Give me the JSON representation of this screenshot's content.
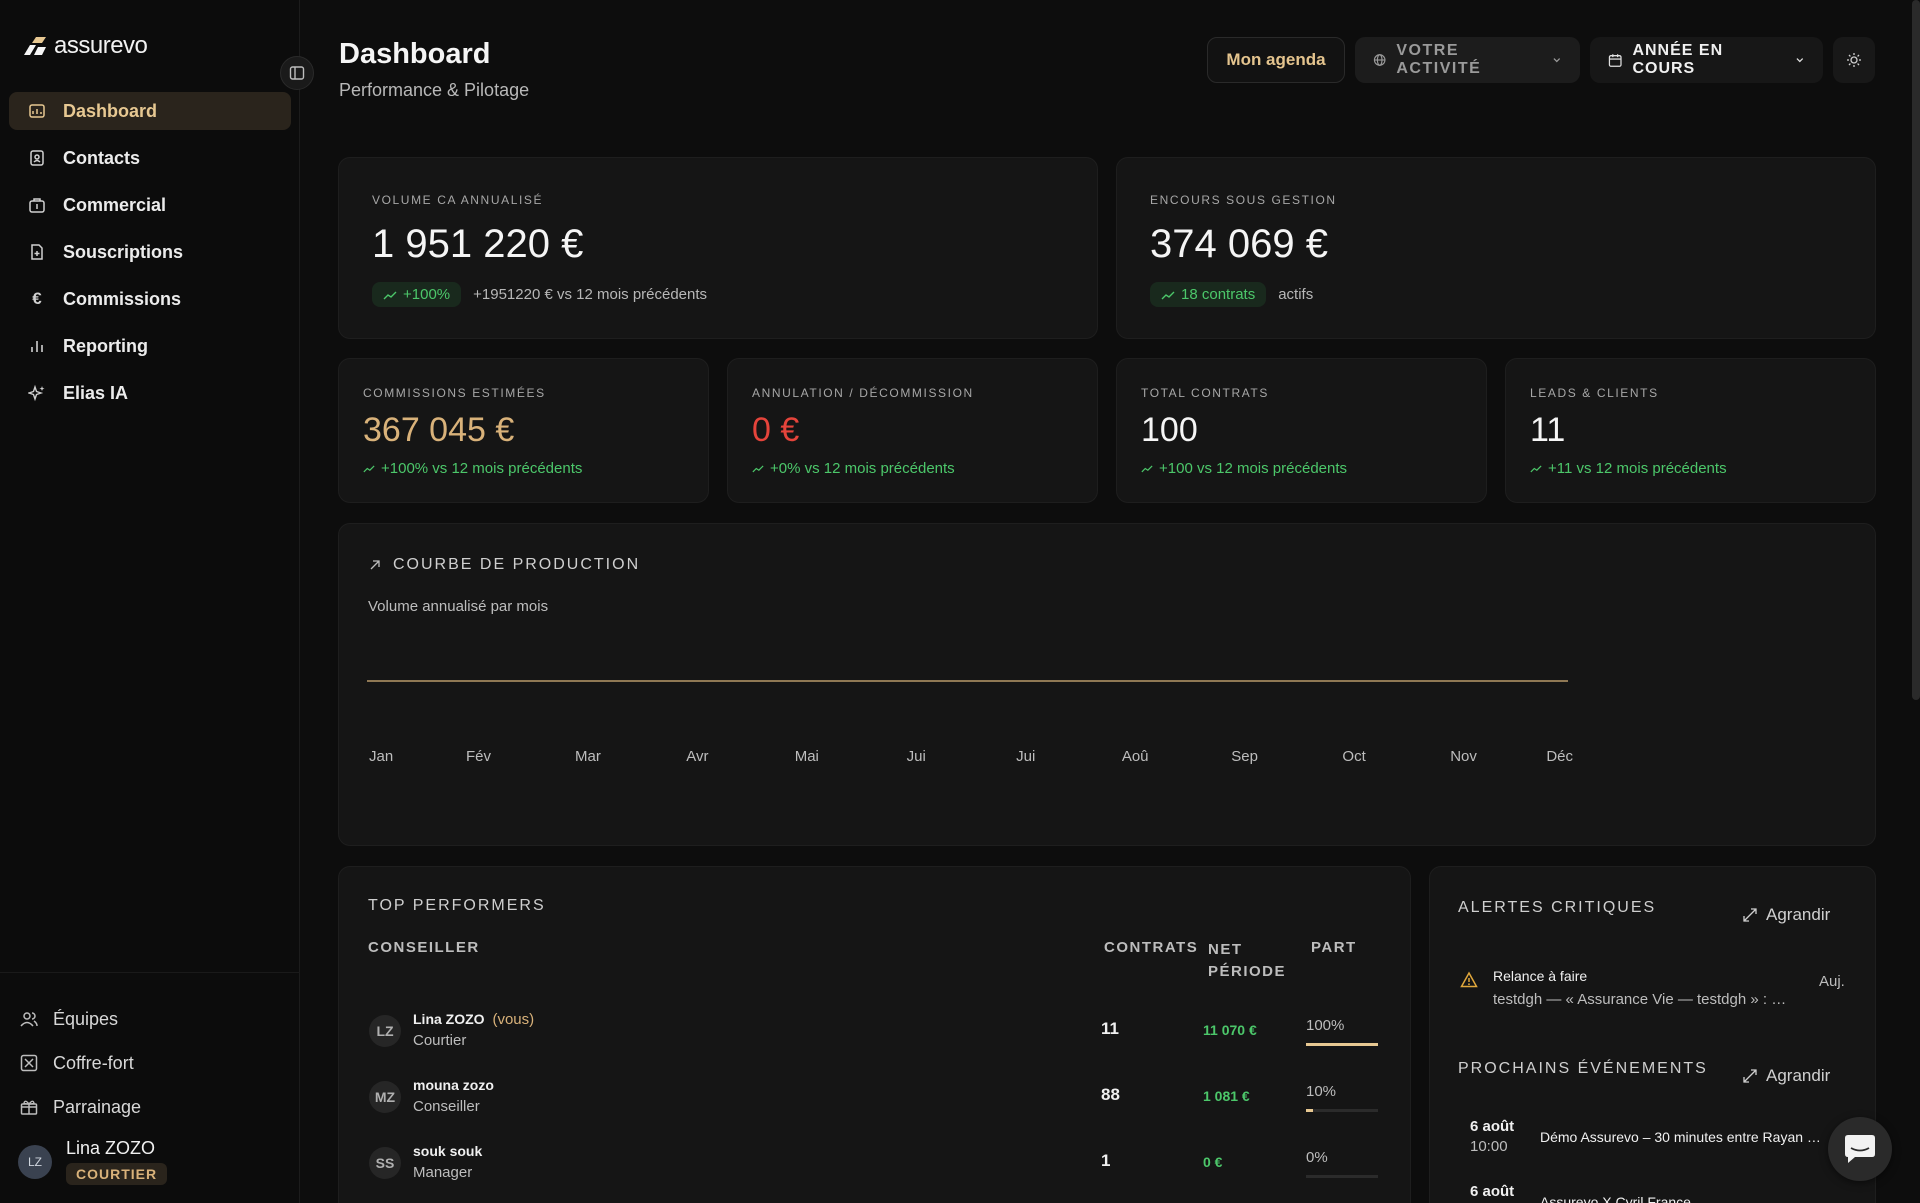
{
  "app": {
    "brand": "assurevo"
  },
  "sidebar": {
    "items": [
      {
        "label": "Dashboard",
        "icon": "dashboard-icon"
      },
      {
        "label": "Contacts",
        "icon": "contacts-icon"
      },
      {
        "label": "Commercial",
        "icon": "briefcase-icon"
      },
      {
        "label": "Souscriptions",
        "icon": "file-plus-icon"
      },
      {
        "label": "Commissions",
        "icon": "euro-icon"
      },
      {
        "label": "Reporting",
        "icon": "bar-chart-icon"
      },
      {
        "label": "Elias IA",
        "icon": "sparkles-icon"
      }
    ],
    "bottom": [
      {
        "label": "Équipes",
        "icon": "users-icon"
      },
      {
        "label": "Coffre-fort",
        "icon": "vault-icon"
      },
      {
        "label": "Parrainage",
        "icon": "gift-icon"
      }
    ],
    "user": {
      "initials": "LZ",
      "name": "Lina ZOZO",
      "role": "COURTIER"
    }
  },
  "header": {
    "title": "Dashboard",
    "subtitle": "Performance & Pilotage",
    "agenda_label": "Mon agenda",
    "activity_label": "VOTRE ACTIVITÉ",
    "year_label": "ANNÉE EN COURS"
  },
  "kpi_top": [
    {
      "label": "VOLUME CA ANNUALISÉ",
      "value": "1 951 220 €",
      "pill": "+100%",
      "note": "+1951220 € vs 12 mois précédents"
    },
    {
      "label": "ENCOURS SOUS GESTION",
      "value": "374 069 €",
      "pill": "18 contrats",
      "note": "actifs"
    }
  ],
  "kpi_small": [
    {
      "label": "COMMISSIONS ESTIMÉES",
      "value": "367 045 €",
      "trend": "+100% vs 12 mois précédents",
      "color": "#d9b27a"
    },
    {
      "label": "ANNULATION / DÉCOMMISSION",
      "value": "0 €",
      "trend": "+0% vs 12 mois précédents",
      "color": "#e5443b"
    },
    {
      "label": "TOTAL CONTRATS",
      "value": "100",
      "trend": "+100 vs 12 mois précédents",
      "color": "#f5f5f5"
    },
    {
      "label": "LEADS & CLIENTS",
      "value": "11",
      "trend": "+11 vs 12 mois précédents",
      "color": "#f5f5f5"
    }
  ],
  "production": {
    "title": "COURBE DE PRODUCTION",
    "subtitle": "Volume annualisé par mois",
    "months": [
      "Jan",
      "Fév",
      "Mar",
      "Avr",
      "Mai",
      "Jui",
      "Jui",
      "Aoû",
      "Sep",
      "Oct",
      "Nov",
      "Déc"
    ]
  },
  "chart_data": {
    "type": "line",
    "title": "COURBE DE PRODUCTION",
    "subtitle": "Volume annualisé par mois",
    "categories": [
      "Jan",
      "Fév",
      "Mar",
      "Avr",
      "Mai",
      "Jui",
      "Jui",
      "Aoû",
      "Sep",
      "Oct",
      "Nov",
      "Déc"
    ],
    "values": [
      0,
      0,
      0,
      0,
      0,
      0,
      0,
      0,
      0,
      0,
      0,
      0
    ],
    "color": "#b89a6a",
    "grid": false
  },
  "performers": {
    "title": "TOP PERFORMERS",
    "headers": {
      "advisor": "CONSEILLER",
      "contracts": "CONTRATS",
      "net": "NET\nPÉRIODE",
      "share": "PART"
    },
    "rows": [
      {
        "initials": "LZ",
        "name": "Lina ZOZO",
        "you": "(vous)",
        "role": "Courtier",
        "contracts": "11",
        "net": "11 070 €",
        "share": "100%",
        "share_value": 1.0
      },
      {
        "initials": "MZ",
        "name": "mouna zozo",
        "you": "",
        "role": "Conseiller",
        "contracts": "88",
        "net": "1 081 €",
        "share": "10%",
        "share_value": 0.1
      },
      {
        "initials": "SS",
        "name": "souk souk",
        "you": "",
        "role": "Manager",
        "contracts": "1",
        "net": "0 €",
        "share": "0%",
        "share_value": 0
      }
    ]
  },
  "alerts": {
    "title": "ALERTES CRITIQUES",
    "expand": "Agrandir",
    "items": [
      {
        "title": "Relance à faire",
        "text": "testdgh — « Assurance Vie — testdgh » : …",
        "when": "Auj."
      }
    ]
  },
  "events": {
    "title": "PROCHAINS ÉVÉNEMENTS",
    "expand": "Agrandir",
    "items": [
      {
        "date": "6 août",
        "time": "10:00",
        "text": "Démo Assurevo – 30 minutes entre Rayan …"
      },
      {
        "date": "6 août",
        "time": "",
        "text": "Assurevo X Cyril France"
      }
    ]
  },
  "colors": {
    "accent": "#e7c892",
    "positive": "#4cc76a",
    "negative": "#e5443b",
    "background": "#0d0d0d",
    "card": "#151515"
  }
}
